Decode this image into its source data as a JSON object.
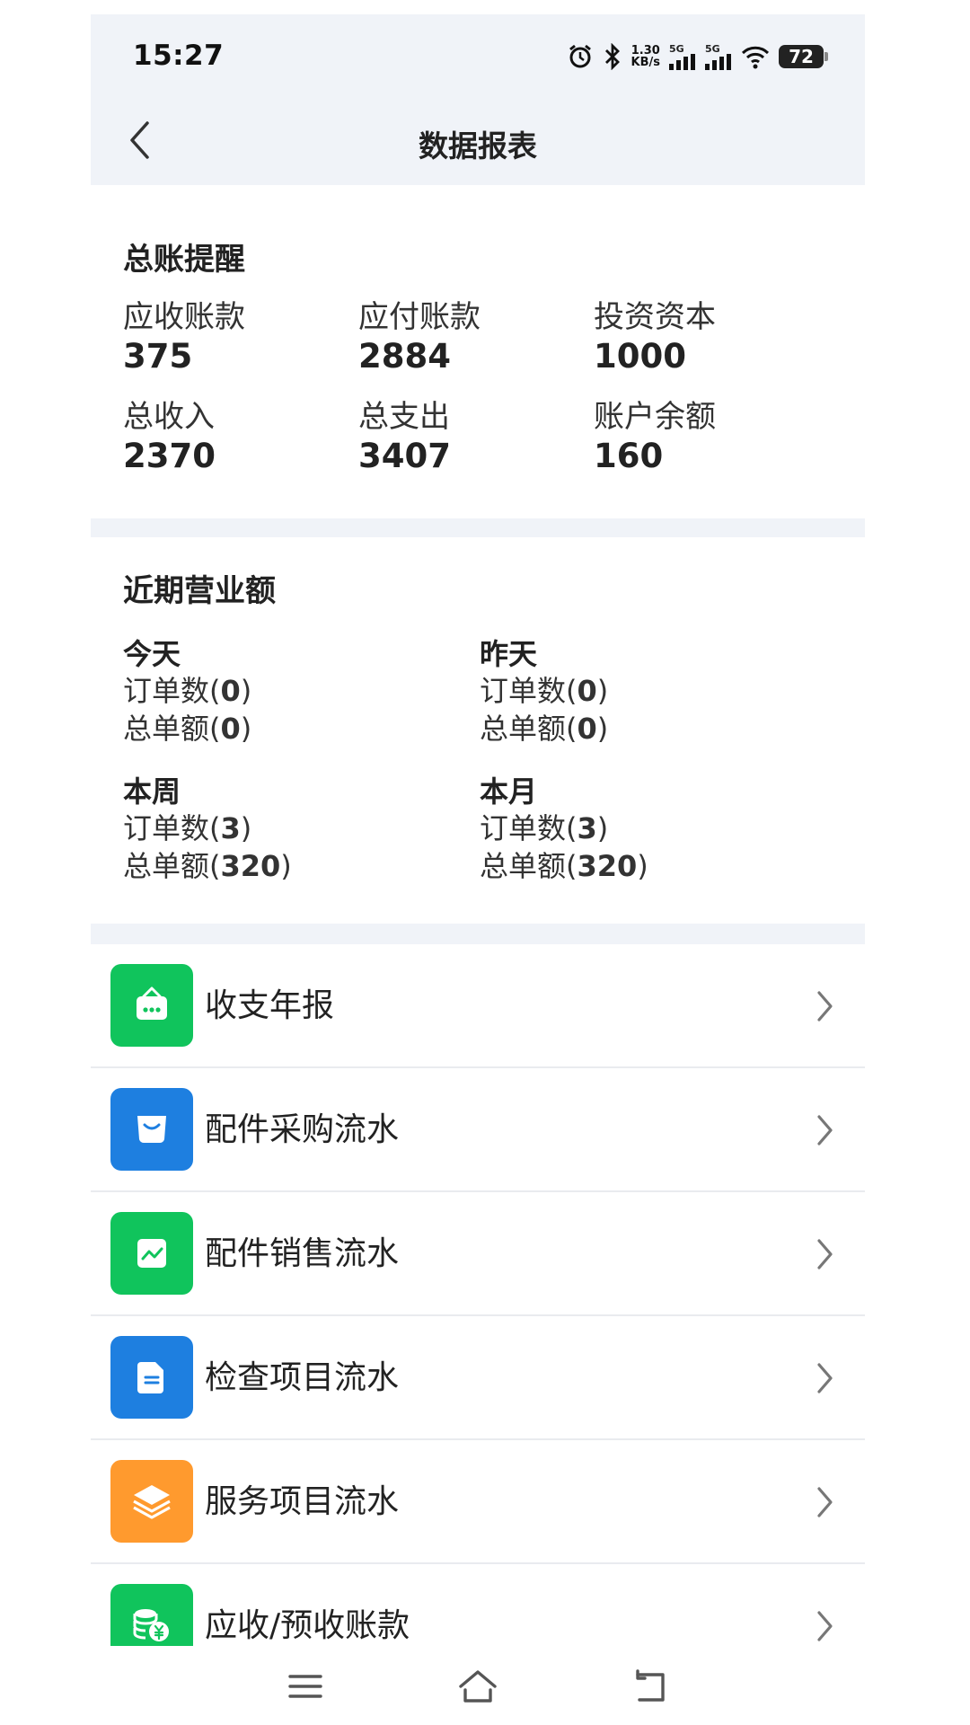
{
  "status_bar": {
    "time": "15:27",
    "net_speed_top": "1.30",
    "net_speed_bottom": "KB/s",
    "signal1": "5G",
    "signal2": "5G",
    "battery": "72",
    "icons": [
      "alarm-icon",
      "bluetooth-icon",
      "signal-icon",
      "signal-icon",
      "wifi-icon",
      "battery-icon"
    ]
  },
  "header": {
    "title": "数据报表"
  },
  "ledger": {
    "title": "总账提醒",
    "stats": [
      {
        "label": "应收账款",
        "value": "375"
      },
      {
        "label": "应付账款",
        "value": "2884"
      },
      {
        "label": "投资资本",
        "value": "1000"
      },
      {
        "label": "总收入",
        "value": "2370"
      },
      {
        "label": "总支出",
        "value": "3407"
      },
      {
        "label": "账户余额",
        "value": "160"
      }
    ]
  },
  "revenue": {
    "title": "近期营业额",
    "order_count_label": "订单数",
    "order_amount_label": "总单额",
    "periods": [
      {
        "name": "今天",
        "orders": "0",
        "amount": "0"
      },
      {
        "name": "昨天",
        "orders": "0",
        "amount": "0"
      },
      {
        "name": "本周",
        "orders": "3",
        "amount": "320"
      },
      {
        "name": "本月",
        "orders": "3",
        "amount": "320"
      }
    ]
  },
  "menu": {
    "items": [
      {
        "label": "收支年报",
        "icon": "shop-icon",
        "color": "#10c45c"
      },
      {
        "label": "配件采购流水",
        "icon": "shopping-bag-icon",
        "color": "#1e7fe0"
      },
      {
        "label": "配件销售流水",
        "icon": "trend-chart-icon",
        "color": "#10c45c"
      },
      {
        "label": "检查项目流水",
        "icon": "document-icon",
        "color": "#1e7fe0"
      },
      {
        "label": "服务项目流水",
        "icon": "layers-icon",
        "color": "#ff9a2e"
      },
      {
        "label": "应收/预收账款",
        "icon": "coins-icon",
        "color": "#10c45c"
      }
    ]
  },
  "system_nav": {
    "icons": [
      "menu-icon",
      "home-icon",
      "back-icon"
    ]
  }
}
